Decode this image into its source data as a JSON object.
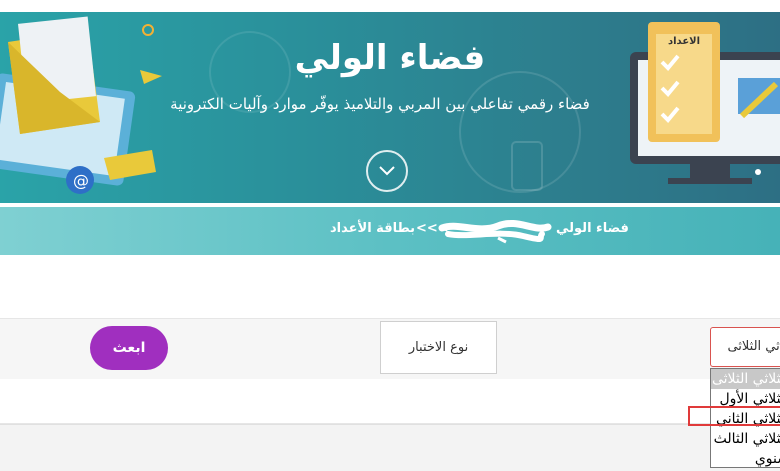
{
  "banner": {
    "title": "فضاء الولي",
    "subtitle": "فضاء رقمي تفاعلي بين المربي والتلاميذ يوفّر موارد وآليات الكترونية",
    "clipboard_label": "الاعداد"
  },
  "breadcrumb": {
    "home": "فضاء الولي",
    "separator": ">>>",
    "current": "بطاقة الأعداد"
  },
  "filters": {
    "submit_label": "ابعث",
    "test_type_label": "نوع الاختبار",
    "level_selected": "الثلاثي الثلاثى"
  },
  "dropdown": {
    "options": [
      {
        "label": "الثلاثي الثلاثى",
        "selected": true
      },
      {
        "label": "الثلاثي الأول",
        "selected": false
      },
      {
        "label": "الثلاثي الثاني",
        "selected": false
      },
      {
        "label": "الثلاثي الثالث",
        "selected": false
      },
      {
        "label": "سنوي",
        "selected": false
      }
    ]
  },
  "colors": {
    "banner": "#2a8f9a",
    "breadcrumb_bar": "#5cc0c4",
    "submit_button": "#a02fbf",
    "highlight": "#e03a3a"
  }
}
